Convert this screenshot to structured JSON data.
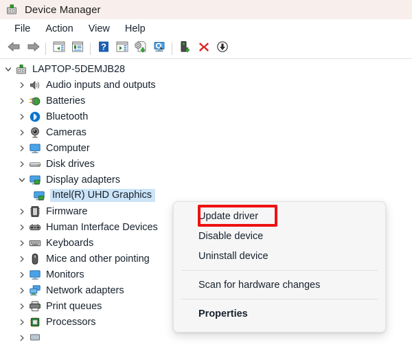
{
  "window": {
    "title": "Device Manager",
    "icon": "device-manager-icon"
  },
  "menubar": {
    "items": [
      {
        "label": "File",
        "name": "menu-file"
      },
      {
        "label": "Action",
        "name": "menu-action"
      },
      {
        "label": "View",
        "name": "menu-view"
      },
      {
        "label": "Help",
        "name": "menu-help"
      }
    ]
  },
  "toolbar": {
    "buttons": [
      {
        "icon": "back-arrow-icon",
        "name": "toolbar-back"
      },
      {
        "icon": "forward-arrow-icon",
        "name": "toolbar-forward"
      },
      {
        "icon": "separator",
        "name": "toolbar-separator-1"
      },
      {
        "icon": "show-hide-console-tree-icon",
        "name": "toolbar-console-tree"
      },
      {
        "icon": "properties-icon",
        "name": "toolbar-properties"
      },
      {
        "icon": "separator",
        "name": "toolbar-separator-2"
      },
      {
        "icon": "help-icon",
        "name": "toolbar-help"
      },
      {
        "icon": "show-hide-action-pane-icon",
        "name": "toolbar-action-pane"
      },
      {
        "icon": "update-driver-icon",
        "name": "toolbar-update-driver"
      },
      {
        "icon": "scan-hardware-changes-icon",
        "name": "toolbar-scan-hardware"
      },
      {
        "icon": "separator",
        "name": "toolbar-separator-3"
      },
      {
        "icon": "enable-device-icon",
        "name": "toolbar-enable-device"
      },
      {
        "icon": "uninstall-device-icon",
        "name": "toolbar-uninstall-device"
      },
      {
        "icon": "download-icon",
        "name": "toolbar-download"
      }
    ]
  },
  "tree": {
    "root": {
      "label": "LAPTOP-5DEMJB28",
      "icon": "computer-root-icon",
      "expanded": true
    },
    "items": [
      {
        "label": "Audio inputs and outputs",
        "icon": "speaker-icon",
        "expanded": false,
        "depth": 1,
        "selected": false
      },
      {
        "label": "Batteries",
        "icon": "battery-icon",
        "expanded": false,
        "depth": 1,
        "selected": false
      },
      {
        "label": "Bluetooth",
        "icon": "bluetooth-icon",
        "expanded": false,
        "depth": 1,
        "selected": false
      },
      {
        "label": "Cameras",
        "icon": "camera-icon",
        "expanded": false,
        "depth": 1,
        "selected": false
      },
      {
        "label": "Computer",
        "icon": "monitor-icon",
        "expanded": false,
        "depth": 1,
        "selected": false
      },
      {
        "label": "Disk drives",
        "icon": "disk-drive-icon",
        "expanded": false,
        "depth": 1,
        "selected": false
      },
      {
        "label": "Display adapters",
        "icon": "display-adapter-icon",
        "expanded": true,
        "depth": 1,
        "selected": false
      },
      {
        "label": "Intel(R) UHD Graphics",
        "icon": "display-adapter-icon",
        "expanded": null,
        "depth": 2,
        "selected": true
      },
      {
        "label": "Firmware",
        "icon": "firmware-icon",
        "expanded": false,
        "depth": 1,
        "selected": false
      },
      {
        "label": "Human Interface Devices",
        "icon": "hid-icon",
        "expanded": false,
        "depth": 1,
        "selected": false
      },
      {
        "label": "Keyboards",
        "icon": "keyboard-icon",
        "expanded": false,
        "depth": 1,
        "selected": false
      },
      {
        "label": "Mice and other pointing",
        "icon": "mouse-icon",
        "expanded": false,
        "depth": 1,
        "selected": false
      },
      {
        "label": "Monitors",
        "icon": "monitor-icon",
        "expanded": false,
        "depth": 1,
        "selected": false
      },
      {
        "label": "Network adapters",
        "icon": "network-adapter-icon",
        "expanded": false,
        "depth": 1,
        "selected": false
      },
      {
        "label": "Print queues",
        "icon": "printer-icon",
        "expanded": false,
        "depth": 1,
        "selected": false
      },
      {
        "label": "Processors",
        "icon": "processor-icon",
        "expanded": false,
        "depth": 1,
        "selected": false
      }
    ]
  },
  "context_menu": {
    "items": [
      {
        "label": "Update driver",
        "name": "ctx-update-driver",
        "bold": false,
        "highlighted": true
      },
      {
        "label": "Disable device",
        "name": "ctx-disable-device",
        "bold": false,
        "highlighted": false
      },
      {
        "label": "Uninstall device",
        "name": "ctx-uninstall-device",
        "bold": false,
        "highlighted": false
      },
      {
        "label": "Scan for hardware changes",
        "name": "ctx-scan-hardware",
        "bold": false,
        "highlighted": false
      },
      {
        "label": "Properties",
        "name": "ctx-properties",
        "bold": true,
        "highlighted": false
      }
    ]
  },
  "colors": {
    "titlebar_bg": "#f8efec",
    "selection_bg": "#cce4f7",
    "highlight_box": "#ee1111",
    "menu_bg": "#f6f6f6",
    "text": "#16202c"
  }
}
